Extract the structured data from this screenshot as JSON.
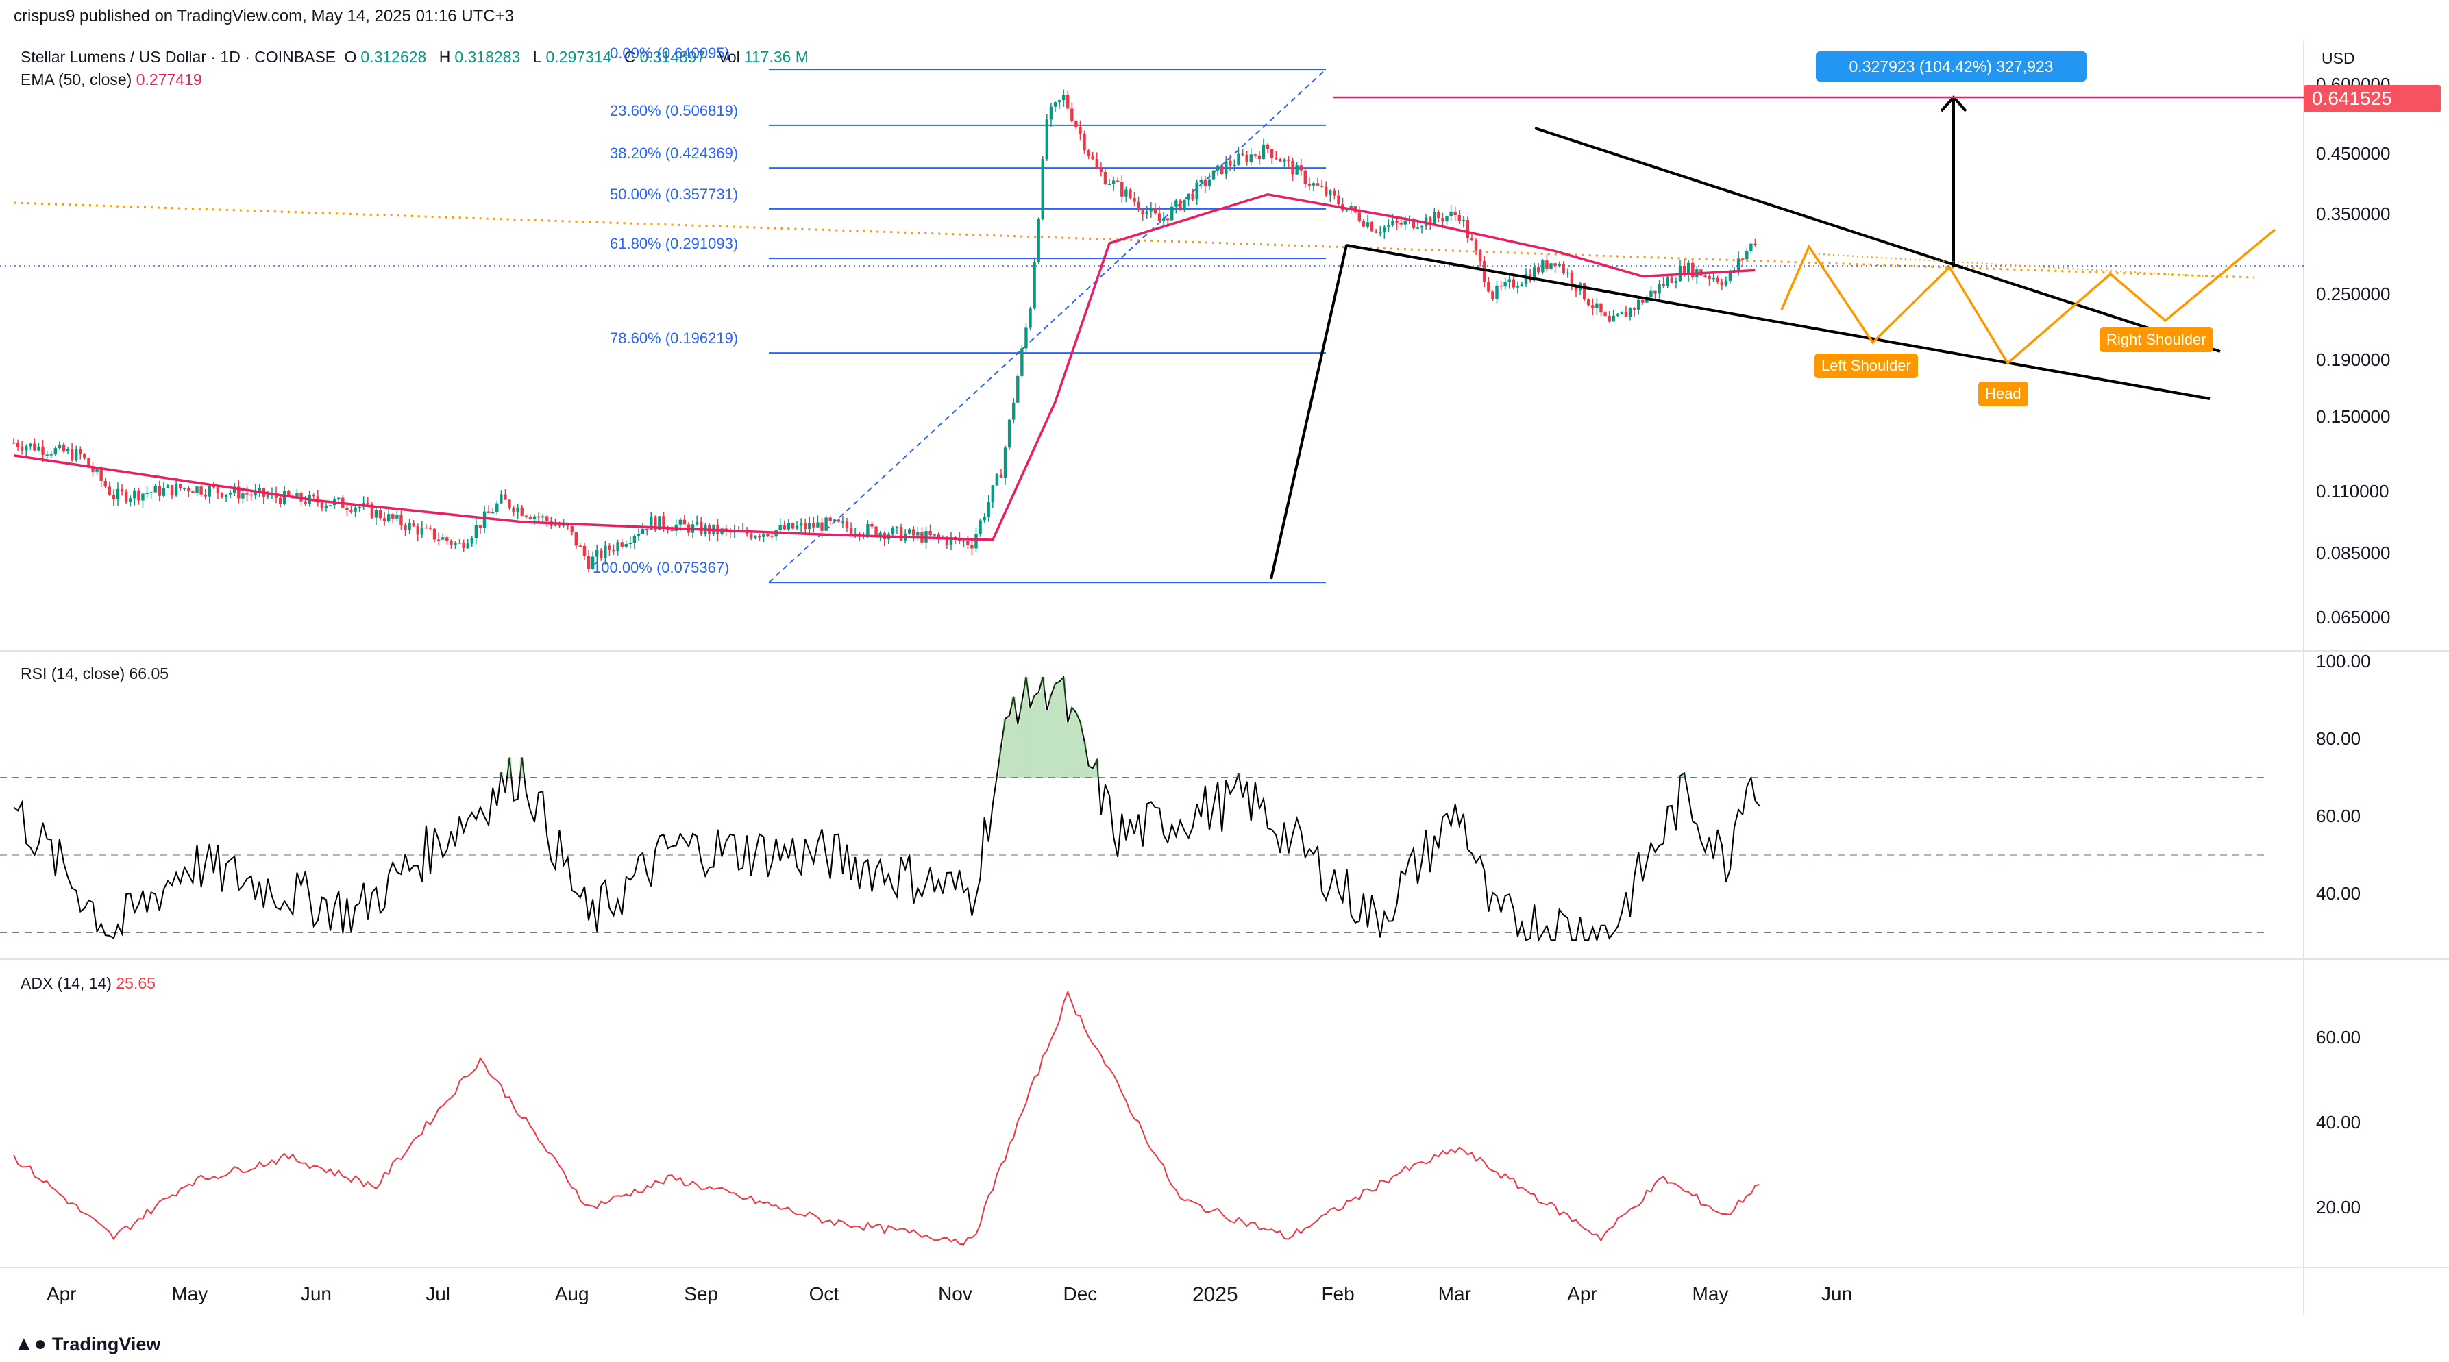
{
  "header": {
    "publisher": "crispus9 published on TradingView.com, May 14, 2025 01:16 UTC+3"
  },
  "legend": {
    "symbol": "Stellar Lumens / US Dollar · 1D · COINBASE",
    "open_label": "O",
    "open": "0.312628",
    "high_label": "H",
    "high": "0.318283",
    "low_label": "L",
    "low": "0.297314",
    "close_label": "C",
    "close": "0.314897",
    "vol_label": "Vol",
    "vol": "117.36 M",
    "ema_label": "EMA (50, close)",
    "ema_value": "0.277419"
  },
  "colors": {
    "up": "#089981",
    "down": "#f23645",
    "ema": "#e91e63",
    "fib": "#2962ff",
    "pattern": "#ff9800",
    "rsi_line": "#000000",
    "adx_line": "#f23645",
    "price_tag": "#f7525f",
    "measure_box": "#2196f3"
  },
  "currency_label": "USD",
  "price_axis": [
    "0.600000",
    "0.450000",
    "0.350000",
    "0.250000",
    "0.190000",
    "0.150000",
    "0.110000",
    "0.085000",
    "0.065000"
  ],
  "last_price_tag": "0.641525",
  "fib_levels": [
    {
      "label": "0.00% (0.640095)",
      "price": 0.640095
    },
    {
      "label": "23.60% (0.506819)",
      "price": 0.506819
    },
    {
      "label": "38.20% (0.424369)",
      "price": 0.424369
    },
    {
      "label": "50.00% (0.357731)",
      "price": 0.357731
    },
    {
      "label": "61.80% (0.291093)",
      "price": 0.291093
    },
    {
      "label": "78.60% (0.196219)",
      "price": 0.196219
    },
    {
      "label": "100.00% (0.075367)",
      "price": 0.075367
    }
  ],
  "measure_label": "0.327923 (104.42%) 327,923",
  "pattern_labels": {
    "left": "Left Shoulder",
    "head": "Head",
    "right": "Right Shoulder"
  },
  "rsi": {
    "label": "RSI (14, close)",
    "value": "66.05",
    "axis": [
      "100.00",
      "80.00",
      "60.00",
      "40.00"
    ]
  },
  "adx": {
    "label": "ADX (14, 14)",
    "value": "25.65",
    "axis": [
      "60.00",
      "40.00",
      "20.00"
    ]
  },
  "time_axis": [
    "Apr",
    "May",
    "Jun",
    "Jul",
    "Aug",
    "Sep",
    "Oct",
    "Nov",
    "Dec",
    "2025",
    "Feb",
    "Mar",
    "Apr",
    "May",
    "Jun"
  ],
  "footer": {
    "brand": "TradingView"
  },
  "chart_data": [
    {
      "type": "candlestick",
      "title": "Stellar Lumens / US Dollar · 1D · COINBASE",
      "ylabel": "USD",
      "yscale": "log",
      "ylim": [
        0.06,
        0.72
      ],
      "x": [
        "Apr",
        "May",
        "Jun",
        "Jul",
        "Aug",
        "Sep",
        "Oct",
        "Nov",
        "Dec",
        "2025",
        "Feb",
        "Mar",
        "Apr",
        "May",
        "Jun"
      ],
      "close_path": [
        [
          "2024-03-20",
          0.135
        ],
        [
          "2024-04-05",
          0.128
        ],
        [
          "2024-04-13",
          0.108
        ],
        [
          "2024-05-01",
          0.112
        ],
        [
          "2024-05-20",
          0.108
        ],
        [
          "2024-06-10",
          0.104
        ],
        [
          "2024-06-25",
          0.094
        ],
        [
          "2024-07-05",
          0.088
        ],
        [
          "2024-07-15",
          0.106
        ],
        [
          "2024-07-31",
          0.094
        ],
        [
          "2024-08-05",
          0.082
        ],
        [
          "2024-08-20",
          0.097
        ],
        [
          "2024-09-10",
          0.092
        ],
        [
          "2024-10-01",
          0.096
        ],
        [
          "2024-10-20",
          0.092
        ],
        [
          "2024-11-05",
          0.089
        ],
        [
          "2024-11-12",
          0.12
        ],
        [
          "2024-11-19",
          0.24
        ],
        [
          "2024-11-23",
          0.52
        ],
        [
          "2024-11-27",
          0.57
        ],
        [
          "2024-12-05",
          0.42
        ],
        [
          "2024-12-20",
          0.34
        ],
        [
          "2025-01-05",
          0.43
        ],
        [
          "2025-01-15",
          0.46
        ],
        [
          "2025-01-25",
          0.4
        ],
        [
          "2025-02-10",
          0.33
        ],
        [
          "2025-03-02",
          0.35
        ],
        [
          "2025-03-10",
          0.25
        ],
        [
          "2025-03-25",
          0.29
        ],
        [
          "2025-04-07",
          0.22
        ],
        [
          "2025-04-25",
          0.28
        ],
        [
          "2025-05-05",
          0.265
        ],
        [
          "2025-05-12",
          0.315
        ]
      ],
      "ema50": [
        [
          "2024-03-20",
          0.128
        ],
        [
          "2024-06-01",
          0.106
        ],
        [
          "2024-07-20",
          0.097
        ],
        [
          "2024-10-01",
          0.092
        ],
        [
          "2024-11-10",
          0.09
        ],
        [
          "2024-11-25",
          0.16
        ],
        [
          "2024-12-08",
          0.31
        ],
        [
          "2025-01-15",
          0.38
        ],
        [
          "2025-02-20",
          0.34
        ],
        [
          "2025-03-25",
          0.3
        ],
        [
          "2025-04-15",
          0.27
        ],
        [
          "2025-05-12",
          0.277
        ]
      ]
    },
    {
      "type": "line",
      "title": "RSI (14, close)",
      "ylim": [
        20,
        100
      ],
      "reference_lines": [
        70,
        50,
        30
      ],
      "values": [
        [
          "2024-03-20",
          62
        ],
        [
          "2024-04-13",
          30
        ],
        [
          "2024-05-01",
          48
        ],
        [
          "2024-06-10",
          35
        ],
        [
          "2024-07-20",
          72
        ],
        [
          "2024-08-05",
          33
        ],
        [
          "2024-08-25",
          52
        ],
        [
          "2024-10-01",
          50
        ],
        [
          "2024-11-05",
          40
        ],
        [
          "2024-11-15",
          90
        ],
        [
          "2024-11-25",
          95
        ],
        [
          "2024-12-10",
          55
        ],
        [
          "2025-01-10",
          65
        ],
        [
          "2025-02-10",
          33
        ],
        [
          "2025-03-02",
          62
        ],
        [
          "2025-03-10",
          34
        ],
        [
          "2025-04-07",
          30
        ],
        [
          "2025-04-25",
          66
        ],
        [
          "2025-05-05",
          48
        ],
        [
          "2025-05-10",
          72
        ],
        [
          "2025-05-13",
          66
        ]
      ]
    },
    {
      "type": "line",
      "title": "ADX (14, 14)",
      "ylim": [
        5,
        75
      ],
      "values": [
        [
          "2024-03-20",
          32
        ],
        [
          "2024-04-13",
          13
        ],
        [
          "2024-05-01",
          26
        ],
        [
          "2024-05-25",
          32
        ],
        [
          "2024-06-15",
          25
        ],
        [
          "2024-07-10",
          55
        ],
        [
          "2024-08-05",
          20
        ],
        [
          "2024-08-25",
          27
        ],
        [
          "2024-10-01",
          17
        ],
        [
          "2024-11-05",
          12
        ],
        [
          "2024-11-28",
          70
        ],
        [
          "2024-12-25",
          22
        ],
        [
          "2025-01-20",
          13
        ],
        [
          "2025-02-15",
          28
        ],
        [
          "2025-03-02",
          34
        ],
        [
          "2025-04-05",
          13
        ],
        [
          "2025-04-20",
          27
        ],
        [
          "2025-05-05",
          18
        ],
        [
          "2025-05-13",
          26
        ]
      ]
    }
  ]
}
